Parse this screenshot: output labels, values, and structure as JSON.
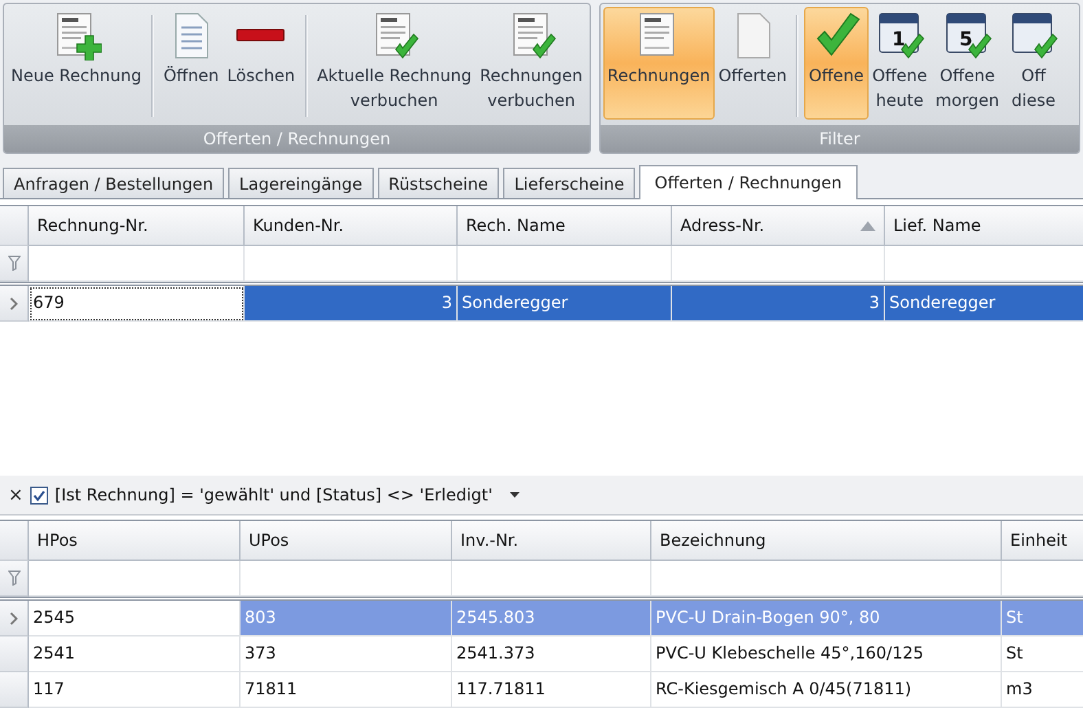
{
  "ribbon": {
    "groups": [
      {
        "title": "Offerten / Rechnungen",
        "sets": [
          [
            {
              "kind": "doc-plus",
              "lines": [
                "Neue Rechnung"
              ],
              "selected": false
            }
          ],
          [
            {
              "kind": "doc",
              "lines": [
                "Öffnen"
              ],
              "selected": false
            },
            {
              "kind": "minus",
              "lines": [
                "Löschen"
              ],
              "selected": false
            }
          ],
          [
            {
              "kind": "doc-check",
              "lines": [
                "Aktuelle Rechnung",
                "verbuchen"
              ],
              "selected": false
            },
            {
              "kind": "doc-check",
              "lines": [
                "Rechnungen",
                "verbuchen"
              ],
              "selected": false
            }
          ]
        ]
      },
      {
        "title": "Filter",
        "sets": [
          [
            {
              "kind": "invoice",
              "lines": [
                "Rechnungen"
              ],
              "selected": true
            },
            {
              "kind": "blank",
              "lines": [
                "Offerten"
              ],
              "selected": false
            }
          ],
          [
            {
              "kind": "check",
              "lines": [
                "Offene"
              ],
              "selected": true
            },
            {
              "kind": "calendar",
              "day": "1",
              "lines": [
                "Offene",
                "heute"
              ],
              "selected": false
            },
            {
              "kind": "calendar",
              "day": "5",
              "lines": [
                "Offene",
                "morgen"
              ],
              "selected": false
            },
            {
              "kind": "calendar",
              "lines": [
                "Off",
                "diese"
              ],
              "selected": false
            }
          ]
        ]
      }
    ]
  },
  "tabs": [
    {
      "label": "Anfragen / Bestellungen",
      "selected": false
    },
    {
      "label": "Lagereingänge",
      "selected": false
    },
    {
      "label": "Rüstscheine",
      "selected": false
    },
    {
      "label": "Lieferscheine",
      "selected": false
    },
    {
      "label": "Offerten / Rechnungen",
      "selected": true
    }
  ],
  "grids": [
    {
      "focused": true,
      "columns": [
        {
          "label": "Rechnung-Nr.",
          "kind": "text"
        },
        {
          "label": "Kunden-Nr.",
          "kind": "number"
        },
        {
          "label": "Rech. Name",
          "kind": "text"
        },
        {
          "label": "Adress-Nr.",
          "kind": "number",
          "sorted_ascending": true
        },
        {
          "label": "Lief. Name",
          "kind": "text"
        }
      ],
      "rows": [
        {
          "selected": true,
          "cells": [
            "679",
            "3",
            "Sonderegger",
            "3",
            "Sonderegger"
          ]
        }
      ]
    },
    {
      "focused": false,
      "columns": [
        {
          "label": "HPos",
          "kind": "text"
        },
        {
          "label": "UPos",
          "kind": "text"
        },
        {
          "label": "Inv.-Nr.",
          "kind": "text"
        },
        {
          "label": "Bezeichnung",
          "kind": "text"
        },
        {
          "label": "Einheit",
          "kind": "text"
        }
      ],
      "rows": [
        {
          "selected": true,
          "cells": [
            "2545",
            "803",
            "2545.803",
            "PVC-U Drain-Bogen 90°,  80",
            "St"
          ]
        },
        {
          "selected": false,
          "cells": [
            "2541",
            "373",
            "2541.373",
            "PVC-U Klebeschelle 45°,160/125",
            "St"
          ]
        },
        {
          "selected": false,
          "cells": [
            "117",
            "71811",
            "117.71811",
            "RC-Kiesgemisch A 0/45(71811)",
            "m3"
          ]
        }
      ]
    }
  ],
  "filter_bar": {
    "close": "×",
    "checked": true,
    "expression": "[Ist Rechnung] = 'gewählt' und [Status] <> 'Erledigt'"
  }
}
